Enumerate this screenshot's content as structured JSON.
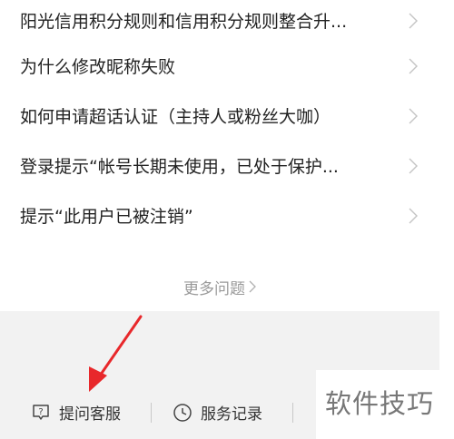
{
  "faq": {
    "items": [
      {
        "label": "阳光信用积分规则和信用积分规则整合升..."
      },
      {
        "label": "为什么修改昵称失败"
      },
      {
        "label": "如何申请超话认证（主持人或粉丝大咖）"
      },
      {
        "label": "登录提示“帐号长期未使用，已处于保护..."
      },
      {
        "label": "提示“此用户已被注销”"
      }
    ],
    "more_label": "更多问题"
  },
  "bottom_bar": {
    "ask_service_label": "提问客服",
    "ask_service_icon": "question-bubble-icon",
    "service_record_label": "服务记录",
    "service_record_icon": "clock-icon"
  },
  "watermark": {
    "text": "软件技巧"
  },
  "colors": {
    "annotation_arrow": "#e8282b",
    "more_text": "#9a9a9a",
    "panel_bg": "#f2f2f2"
  }
}
